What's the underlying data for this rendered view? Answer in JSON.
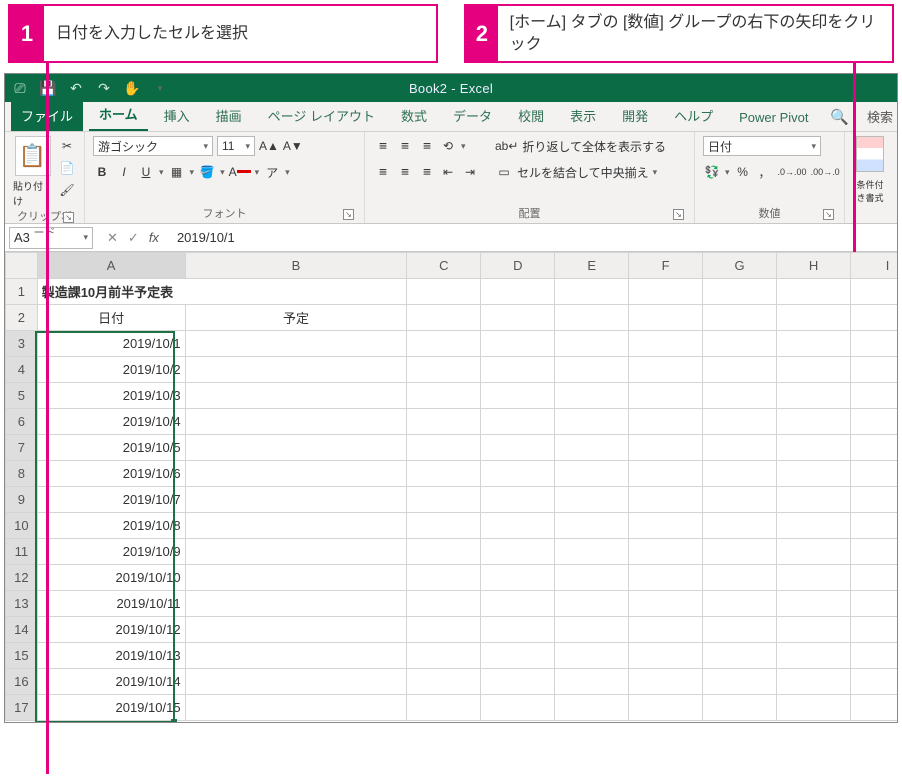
{
  "callouts": [
    {
      "num": "1",
      "text": "日付を入力したセルを選択"
    },
    {
      "num": "2",
      "text": "[ホーム] タブの [数値] グループの右下の矢印をクリック"
    }
  ],
  "titlebar": {
    "title": "Book2  -  Excel"
  },
  "tabs": {
    "file": "ファイル",
    "items": [
      "ホーム",
      "挿入",
      "描画",
      "ページ レイアウト",
      "数式",
      "データ",
      "校閲",
      "表示",
      "開発",
      "ヘルプ",
      "Power Pivot"
    ],
    "search": "検索"
  },
  "ribbon": {
    "clipboard": {
      "label": "クリップボード",
      "paste": "貼り付け"
    },
    "font": {
      "label": "フォント",
      "name": "游ゴシック",
      "size": "11",
      "bold": "B",
      "italic": "I",
      "underline": "U"
    },
    "align": {
      "label": "配置",
      "wrap": "折り返して全体を表示する",
      "merge": "セルを結合して中央揃え"
    },
    "number": {
      "label": "数値",
      "format": "日付",
      "percent": "%",
      "comma": "，",
      "dec_inc": ".00→.0",
      "dec_dec": ".0→.00"
    },
    "styles": {
      "cond": "条件付き書式"
    }
  },
  "fbar": {
    "name": "A3",
    "fx": "fx",
    "value": "2019/10/1"
  },
  "sheet": {
    "cols": [
      "A",
      "B",
      "C",
      "D",
      "E",
      "F",
      "G",
      "H",
      "I"
    ],
    "title": "製造課10月前半予定表",
    "h_date": "日付",
    "h_plan": "予定",
    "dates": [
      "2019/10/1",
      "2019/10/2",
      "2019/10/3",
      "2019/10/4",
      "2019/10/5",
      "2019/10/6",
      "2019/10/7",
      "2019/10/8",
      "2019/10/9",
      "2019/10/10",
      "2019/10/11",
      "2019/10/12",
      "2019/10/13",
      "2019/10/14",
      "2019/10/15"
    ]
  }
}
